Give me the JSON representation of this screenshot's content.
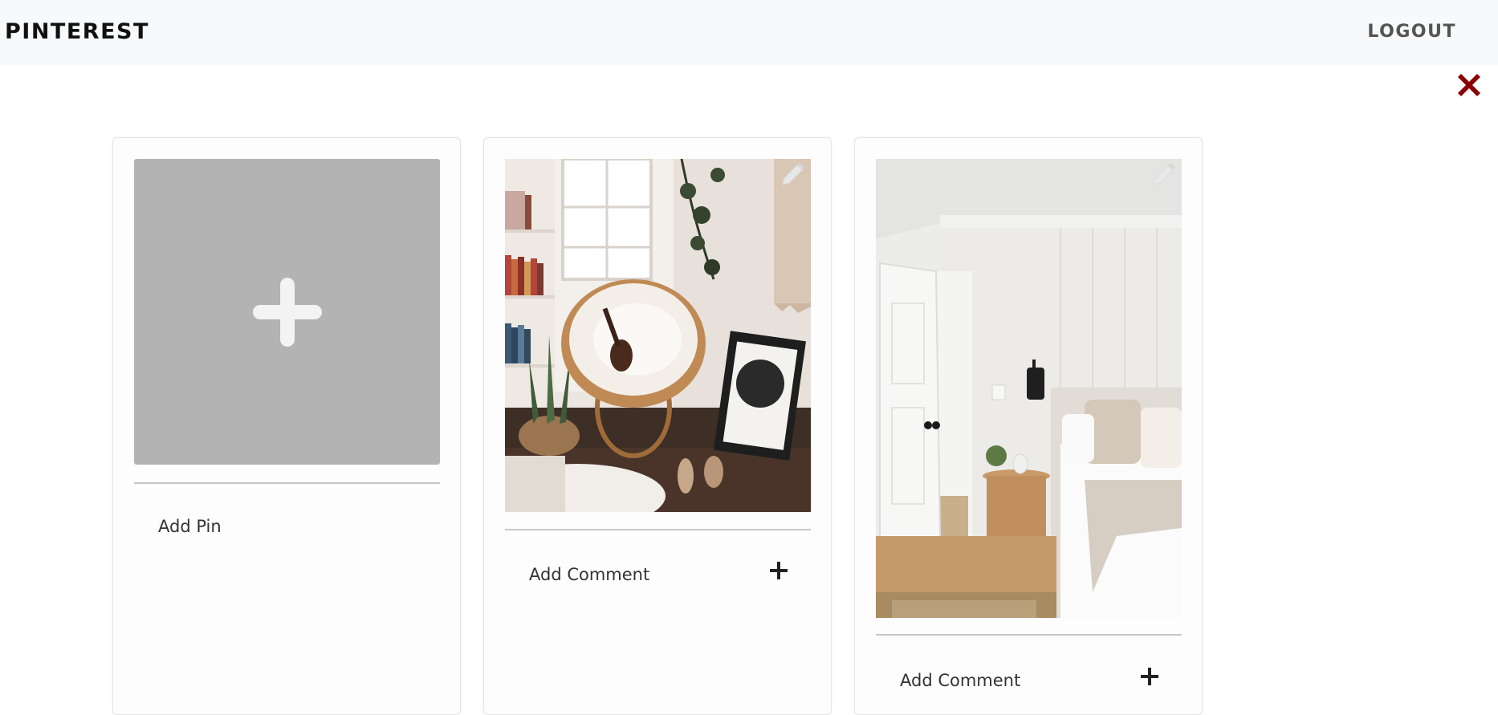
{
  "navbar": {
    "brand": "PINTEREST",
    "logout_label": "LOGOUT"
  },
  "close_icon": "close-icon",
  "add_card": {
    "label": "Add Pin",
    "icon": "plus-icon"
  },
  "pins": [
    {
      "image": "cozy-reading-nook-photo",
      "comment_label": "Add Comment",
      "edit_icon": "pencil-icon",
      "add_icon": "plus-icon"
    },
    {
      "image": "white-bedroom-photo",
      "comment_label": "Add Comment",
      "edit_icon": "pencil-icon",
      "add_icon": "plus-icon"
    }
  ],
  "colors": {
    "navbar_bg": "#f8f9fa",
    "close_red": "#8b0000",
    "add_tile_bg": "#b3b3b3"
  }
}
